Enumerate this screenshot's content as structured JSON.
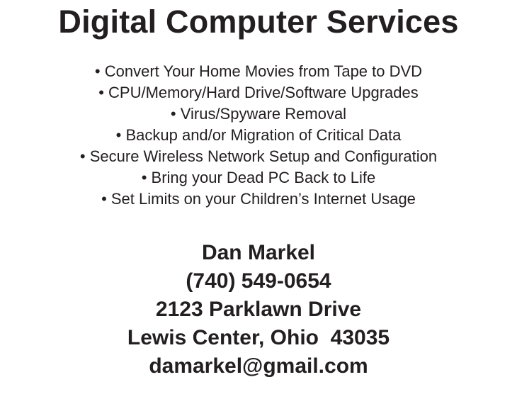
{
  "title": "Digital Computer Services",
  "services": [
    "• Convert Your Home Movies from Tape to DVD",
    "• CPU/Memory/Hard Drive/Software Upgrades",
    "• Virus/Spyware Removal",
    "• Backup and/or Migration of Critical Data",
    "• Secure Wireless Network Setup and Configuration",
    "• Bring your Dead PC Back to Life",
    "• Set Limits on your Children’s Internet Usage"
  ],
  "contact": {
    "name": "Dan Markel",
    "phone": "(740) 549-0654",
    "street": "2123 Parklawn Drive",
    "city_state_zip": "Lewis Center, Ohio  43035",
    "email": "damarkel@gmail.com"
  }
}
